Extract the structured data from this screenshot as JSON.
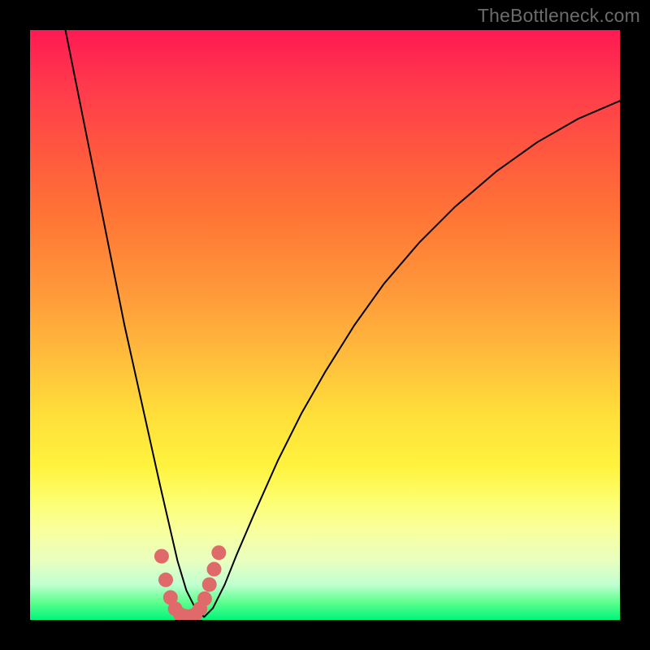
{
  "watermark": "TheBottleneck.com",
  "colors": {
    "page_bg": "#000000",
    "gradient_top": "#ff1a52",
    "gradient_bottom": "#00f57b",
    "curve": "#000000",
    "marker": "#e06a6a"
  },
  "chart_data": {
    "type": "line",
    "title": "",
    "xlabel": "",
    "ylabel": "",
    "xlim": [
      0,
      100
    ],
    "ylim": [
      0,
      100
    ],
    "series": [
      {
        "name": "bottleneck-curve",
        "x": [
          6,
          8,
          10,
          12,
          14,
          16,
          18,
          20,
          22,
          23.5,
          25,
          26.5,
          28,
          29.5,
          31,
          33,
          35,
          38,
          42,
          46,
          50,
          55,
          60,
          66,
          72,
          79,
          86,
          93,
          100
        ],
        "y": [
          100,
          90,
          80,
          70,
          60,
          50,
          41,
          32,
          23,
          16.5,
          10,
          5,
          2,
          0.5,
          2,
          6,
          11,
          18,
          27,
          35,
          42,
          50,
          57,
          64,
          70,
          76,
          81,
          85,
          88
        ]
      }
    ],
    "marker_region": {
      "x": [
        22.3,
        23.0,
        23.8,
        24.6,
        25.5,
        26.4,
        27.3,
        28.0,
        28.8,
        29.6,
        30.4,
        31.2,
        32.0
      ],
      "y": [
        10.8,
        6.8,
        3.8,
        1.9,
        0.9,
        0.6,
        0.6,
        0.9,
        1.9,
        3.6,
        6.0,
        8.6,
        11.4
      ]
    },
    "annotations": []
  }
}
